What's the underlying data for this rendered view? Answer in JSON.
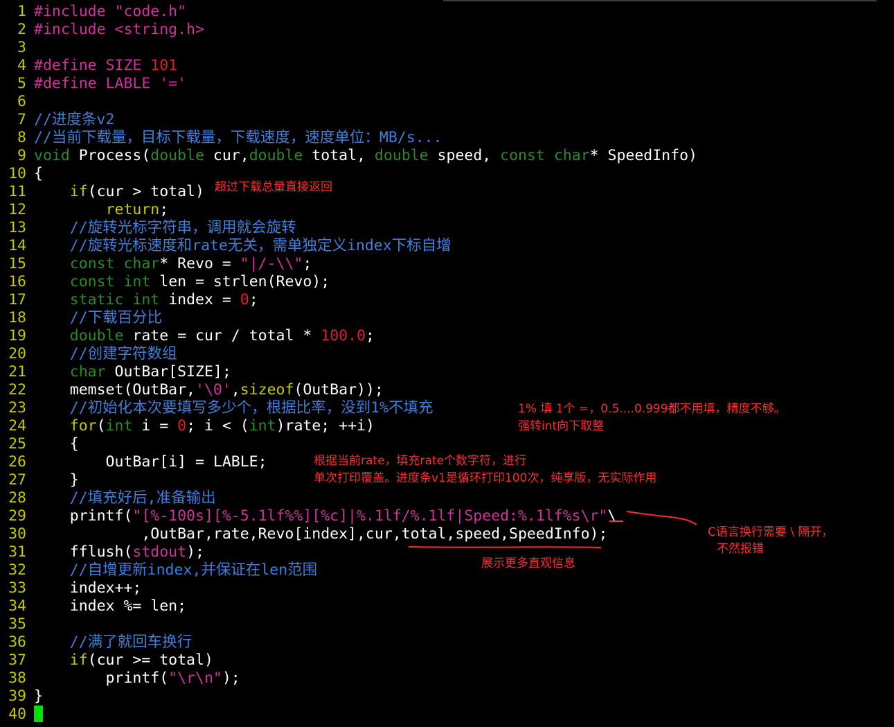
{
  "editor": {
    "lines": [
      {
        "n": "1",
        "t": [
          [
            "#include ",
            "pp"
          ],
          [
            "\"code.h\"",
            "str"
          ]
        ]
      },
      {
        "n": "2",
        "t": [
          [
            "#include ",
            "pp"
          ],
          [
            "<string.h>",
            "str"
          ]
        ]
      },
      {
        "n": "3",
        "t": []
      },
      {
        "n": "4",
        "t": [
          [
            "#define SIZE ",
            "pp"
          ],
          [
            "101",
            "num"
          ]
        ]
      },
      {
        "n": "5",
        "t": [
          [
            "#define LABLE ",
            "pp"
          ],
          [
            "'='",
            "str"
          ]
        ]
      },
      {
        "n": "6",
        "t": []
      },
      {
        "n": "7",
        "t": [
          [
            "//进度条v2",
            "cm"
          ]
        ]
      },
      {
        "n": "8",
        "t": [
          [
            "//当前下载量，目标下载量，下载速度，速度单位：MB/s...",
            "cm"
          ]
        ]
      },
      {
        "n": "9",
        "t": [
          [
            "void",
            "kw"
          ],
          [
            " Process(",
            ""
          ],
          [
            "double",
            "kw"
          ],
          [
            " cur,",
            ""
          ],
          [
            "double",
            "kw"
          ],
          [
            " total, ",
            ""
          ],
          [
            "double",
            "kw"
          ],
          [
            " speed, ",
            ""
          ],
          [
            "const",
            "kw"
          ],
          [
            " ",
            ""
          ],
          [
            "char",
            "kw"
          ],
          [
            "* SpeedInfo)",
            ""
          ]
        ]
      },
      {
        "n": "10",
        "t": [
          [
            "{",
            ""
          ]
        ]
      },
      {
        "n": "11",
        "t": [
          [
            "    ",
            ""
          ],
          [
            "if",
            "stmt"
          ],
          [
            "(cur > total)",
            ""
          ]
        ]
      },
      {
        "n": "12",
        "t": [
          [
            "        ",
            ""
          ],
          [
            "return",
            "stmt"
          ],
          [
            ";",
            ""
          ]
        ]
      },
      {
        "n": "13",
        "t": [
          [
            "    ",
            ""
          ],
          [
            "//旋转光标字符串，调用就会旋转",
            "cm"
          ]
        ]
      },
      {
        "n": "14",
        "t": [
          [
            "    ",
            ""
          ],
          [
            "//旋转光标速度和rate无关，需单独定义index下标自增",
            "cm"
          ]
        ]
      },
      {
        "n": "15",
        "t": [
          [
            "    ",
            ""
          ],
          [
            "const",
            "kw"
          ],
          [
            " ",
            ""
          ],
          [
            "char",
            "kw"
          ],
          [
            "* Revo = ",
            ""
          ],
          [
            "\"|/-\\\\\"",
            "str"
          ],
          [
            ";",
            ""
          ]
        ]
      },
      {
        "n": "16",
        "t": [
          [
            "    ",
            ""
          ],
          [
            "const",
            "kw"
          ],
          [
            " ",
            ""
          ],
          [
            "int",
            "kw"
          ],
          [
            " len = strlen(Revo);",
            ""
          ]
        ]
      },
      {
        "n": "17",
        "t": [
          [
            "    ",
            ""
          ],
          [
            "static",
            "kw"
          ],
          [
            " ",
            ""
          ],
          [
            "int",
            "kw"
          ],
          [
            " index = ",
            ""
          ],
          [
            "0",
            "num"
          ],
          [
            ";",
            ""
          ]
        ]
      },
      {
        "n": "18",
        "t": [
          [
            "    ",
            ""
          ],
          [
            "//下载百分比",
            "cm"
          ]
        ]
      },
      {
        "n": "19",
        "t": [
          [
            "    ",
            ""
          ],
          [
            "double",
            "kw"
          ],
          [
            " rate = cur / total * ",
            ""
          ],
          [
            "100.0",
            "num"
          ],
          [
            ";",
            ""
          ]
        ]
      },
      {
        "n": "20",
        "t": [
          [
            "    ",
            ""
          ],
          [
            "//创建字符数组",
            "cm"
          ]
        ]
      },
      {
        "n": "21",
        "t": [
          [
            "    ",
            ""
          ],
          [
            "char",
            "kw"
          ],
          [
            " OutBar[SIZE];",
            ""
          ]
        ]
      },
      {
        "n": "22",
        "t": [
          [
            "    memset(OutBar,",
            ""
          ],
          [
            "'\\0'",
            "str"
          ],
          [
            ",",
            ""
          ],
          [
            "sizeof",
            "stmt"
          ],
          [
            "(OutBar));",
            ""
          ]
        ]
      },
      {
        "n": "23",
        "t": [
          [
            "    ",
            ""
          ],
          [
            "//初始化本次要填写多少个，根据比率，没到1%不填充",
            "cm"
          ]
        ]
      },
      {
        "n": "24",
        "t": [
          [
            "    ",
            ""
          ],
          [
            "for",
            "stmt"
          ],
          [
            "(",
            ""
          ],
          [
            "int",
            "kw"
          ],
          [
            " i = ",
            ""
          ],
          [
            "0",
            "num"
          ],
          [
            "; i < (",
            ""
          ],
          [
            "int",
            "kw"
          ],
          [
            ")rate; ++i)",
            ""
          ]
        ]
      },
      {
        "n": "25",
        "t": [
          [
            "    {",
            ""
          ]
        ]
      },
      {
        "n": "26",
        "t": [
          [
            "        OutBar[i] = LABLE;",
            ""
          ]
        ]
      },
      {
        "n": "27",
        "t": [
          [
            "    }",
            ""
          ]
        ]
      },
      {
        "n": "28",
        "t": [
          [
            "    ",
            ""
          ],
          [
            "//填充好后,准备输出",
            "cm"
          ]
        ]
      },
      {
        "n": "29",
        "t": [
          [
            "    printf(",
            ""
          ],
          [
            "\"[%-100s][%-5.1lf%%][%c]|%.1lf/%.1lf|Speed:%.1lf%s\\r\"",
            "str"
          ],
          [
            "\\",
            ""
          ]
        ]
      },
      {
        "n": "30",
        "t": [
          [
            "            ,OutBar,rate,Revo[index],cur,total,speed,SpeedInfo);",
            ""
          ]
        ]
      },
      {
        "n": "31",
        "t": [
          [
            "    fflush(",
            ""
          ],
          [
            "stdout",
            "str"
          ],
          [
            ");",
            ""
          ]
        ]
      },
      {
        "n": "32",
        "t": [
          [
            "    ",
            ""
          ],
          [
            "//自增更新index,并保证在len范围",
            "cm"
          ]
        ]
      },
      {
        "n": "33",
        "t": [
          [
            "    index++;",
            ""
          ]
        ]
      },
      {
        "n": "34",
        "t": [
          [
            "    index %= len;",
            ""
          ]
        ]
      },
      {
        "n": "35",
        "t": []
      },
      {
        "n": "36",
        "t": [
          [
            "    ",
            ""
          ],
          [
            "//满了就回车换行",
            "cm"
          ]
        ]
      },
      {
        "n": "37",
        "t": [
          [
            "    ",
            ""
          ],
          [
            "if",
            "stmt"
          ],
          [
            "(cur >= total)",
            ""
          ]
        ]
      },
      {
        "n": "38",
        "t": [
          [
            "        printf(",
            ""
          ],
          [
            "\"\\r\\n\"",
            "str"
          ],
          [
            ");",
            ""
          ]
        ]
      },
      {
        "n": "39",
        "t": [
          [
            "}",
            ""
          ]
        ]
      },
      {
        "n": "40",
        "t": [],
        "cursor": true
      }
    ]
  },
  "annotations": {
    "return_note": "超过下载总量直接返回",
    "fill_note_1": "1% 填 1个 =，0.5....0.999都不用填，精度不够。",
    "fill_note_2": "强转int向下取整",
    "label_note_1": "根据当前rate，填充rate个数字符，进行",
    "label_note_2": "单次打印覆盖。进度条v1是循环打印100次，纯享版，无实际作用",
    "newline_note_1": "C语言换行需要 \\ 隔开，",
    "newline_note_2": "不然报错",
    "info_note": "展示更多直观信息"
  },
  "colors": {
    "background": "#000000",
    "line_number": "#c8c800",
    "keyword_type": "#2a8a2a",
    "statement": "#c8c800",
    "string": "#d0309a",
    "number": "#e02020",
    "comment": "#3f7fdc",
    "annotation": "#ff2a2a",
    "cursor": "#00e000"
  }
}
